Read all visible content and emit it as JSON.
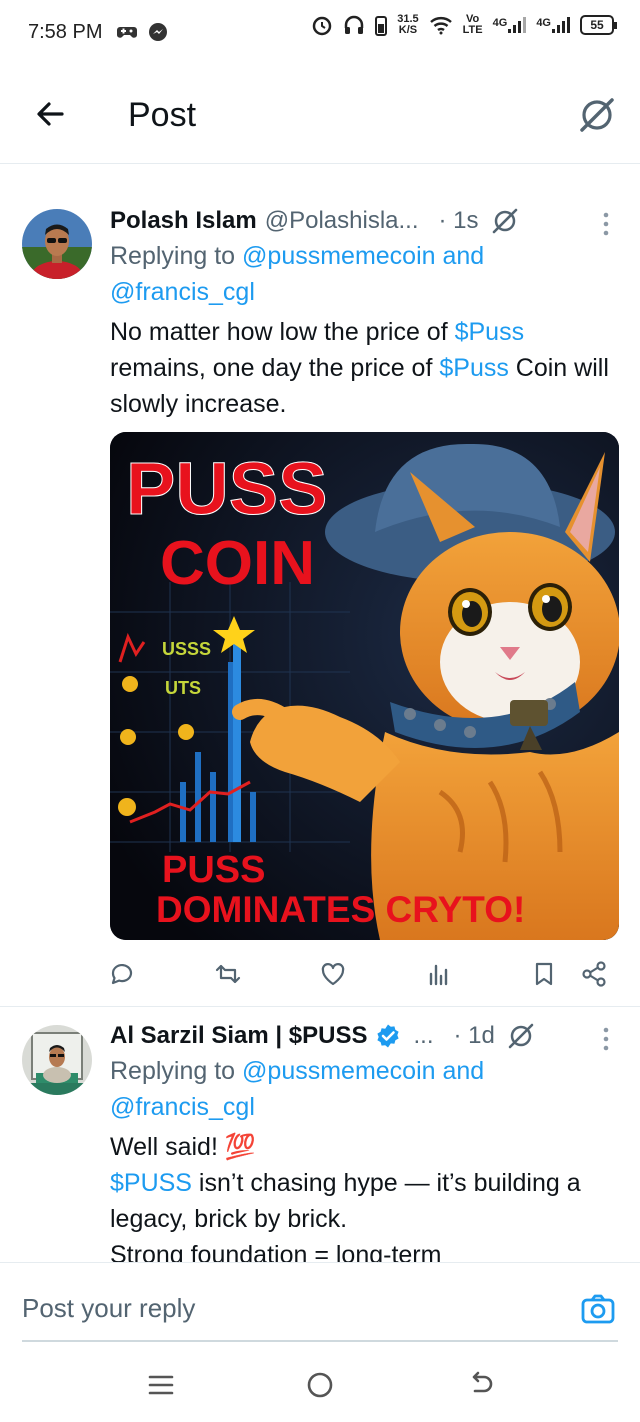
{
  "status_bar": {
    "time": "7:58 PM",
    "speed_value": "31.5",
    "speed_unit": "K/S",
    "volte_top": "Vo",
    "volte_bottom": "LTE",
    "net1": "4G",
    "net2": "4G",
    "battery": "55"
  },
  "header": {
    "title": "Post"
  },
  "posts": [
    {
      "author": "Polash Islam",
      "handle": "@Polashisla...",
      "time": "· 1s",
      "replying_prefix": "Replying to ",
      "mention1": "@pussmemecoin",
      "and": " and",
      "mention2": "@francis_cgl",
      "text_a": "No matter how low the price of ",
      "cash_a": "$Puss",
      "text_b": " remains, one day the price of ",
      "cash_b": "$Puss",
      "text_c": " Coin will slowly increase.",
      "media": {
        "title_line1": "PUSS",
        "title_line2": "COIN",
        "chart_label1": "USSS",
        "chart_label2": "UTS",
        "bottom_line1": "PUSS",
        "bottom_line2": "DOMINATES CRYTO!"
      }
    },
    {
      "author": "Al Sarzil Siam | $PUSS",
      "ellipsis": "...",
      "time": "· 1d",
      "replying_prefix": "Replying to ",
      "mention1": "@pussmemecoin",
      "and": " and",
      "mention2": "@francis_cgl",
      "line1": "Well said! 💯",
      "cash": "$PUSS",
      "line2": " isn’t chasing hype — it’s building a legacy, brick by brick.",
      "line3": "Strong foundation = long-term"
    }
  ],
  "reply_bar": {
    "placeholder": "Post your reply"
  },
  "colors": {
    "accent": "#1d9bf0",
    "muted": "#536471",
    "text": "#0f1419"
  }
}
